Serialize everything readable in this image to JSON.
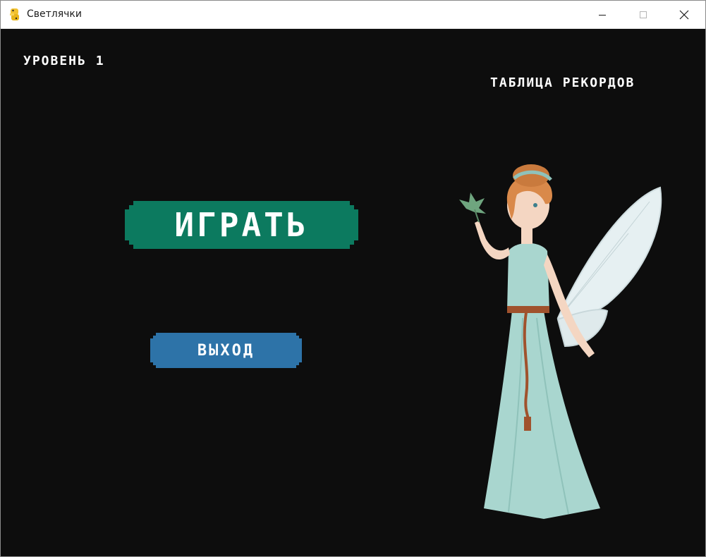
{
  "window": {
    "title": "Светлячки",
    "icon": "python-snake-icon",
    "controls": [
      "minimize-icon",
      "maximize-icon",
      "close-icon"
    ]
  },
  "game": {
    "level_label": "УРОВЕНЬ 1",
    "records_label": "ТАБЛИЦА РЕКОРДОВ",
    "play_label": "ИГРАТЬ",
    "exit_label": "ВЫХОД",
    "character": "fairy-character"
  },
  "colors": {
    "background": "#0d0d0d",
    "play_button": "#0c7a5f",
    "exit_button": "#2d73a8",
    "text": "#ffffff"
  }
}
